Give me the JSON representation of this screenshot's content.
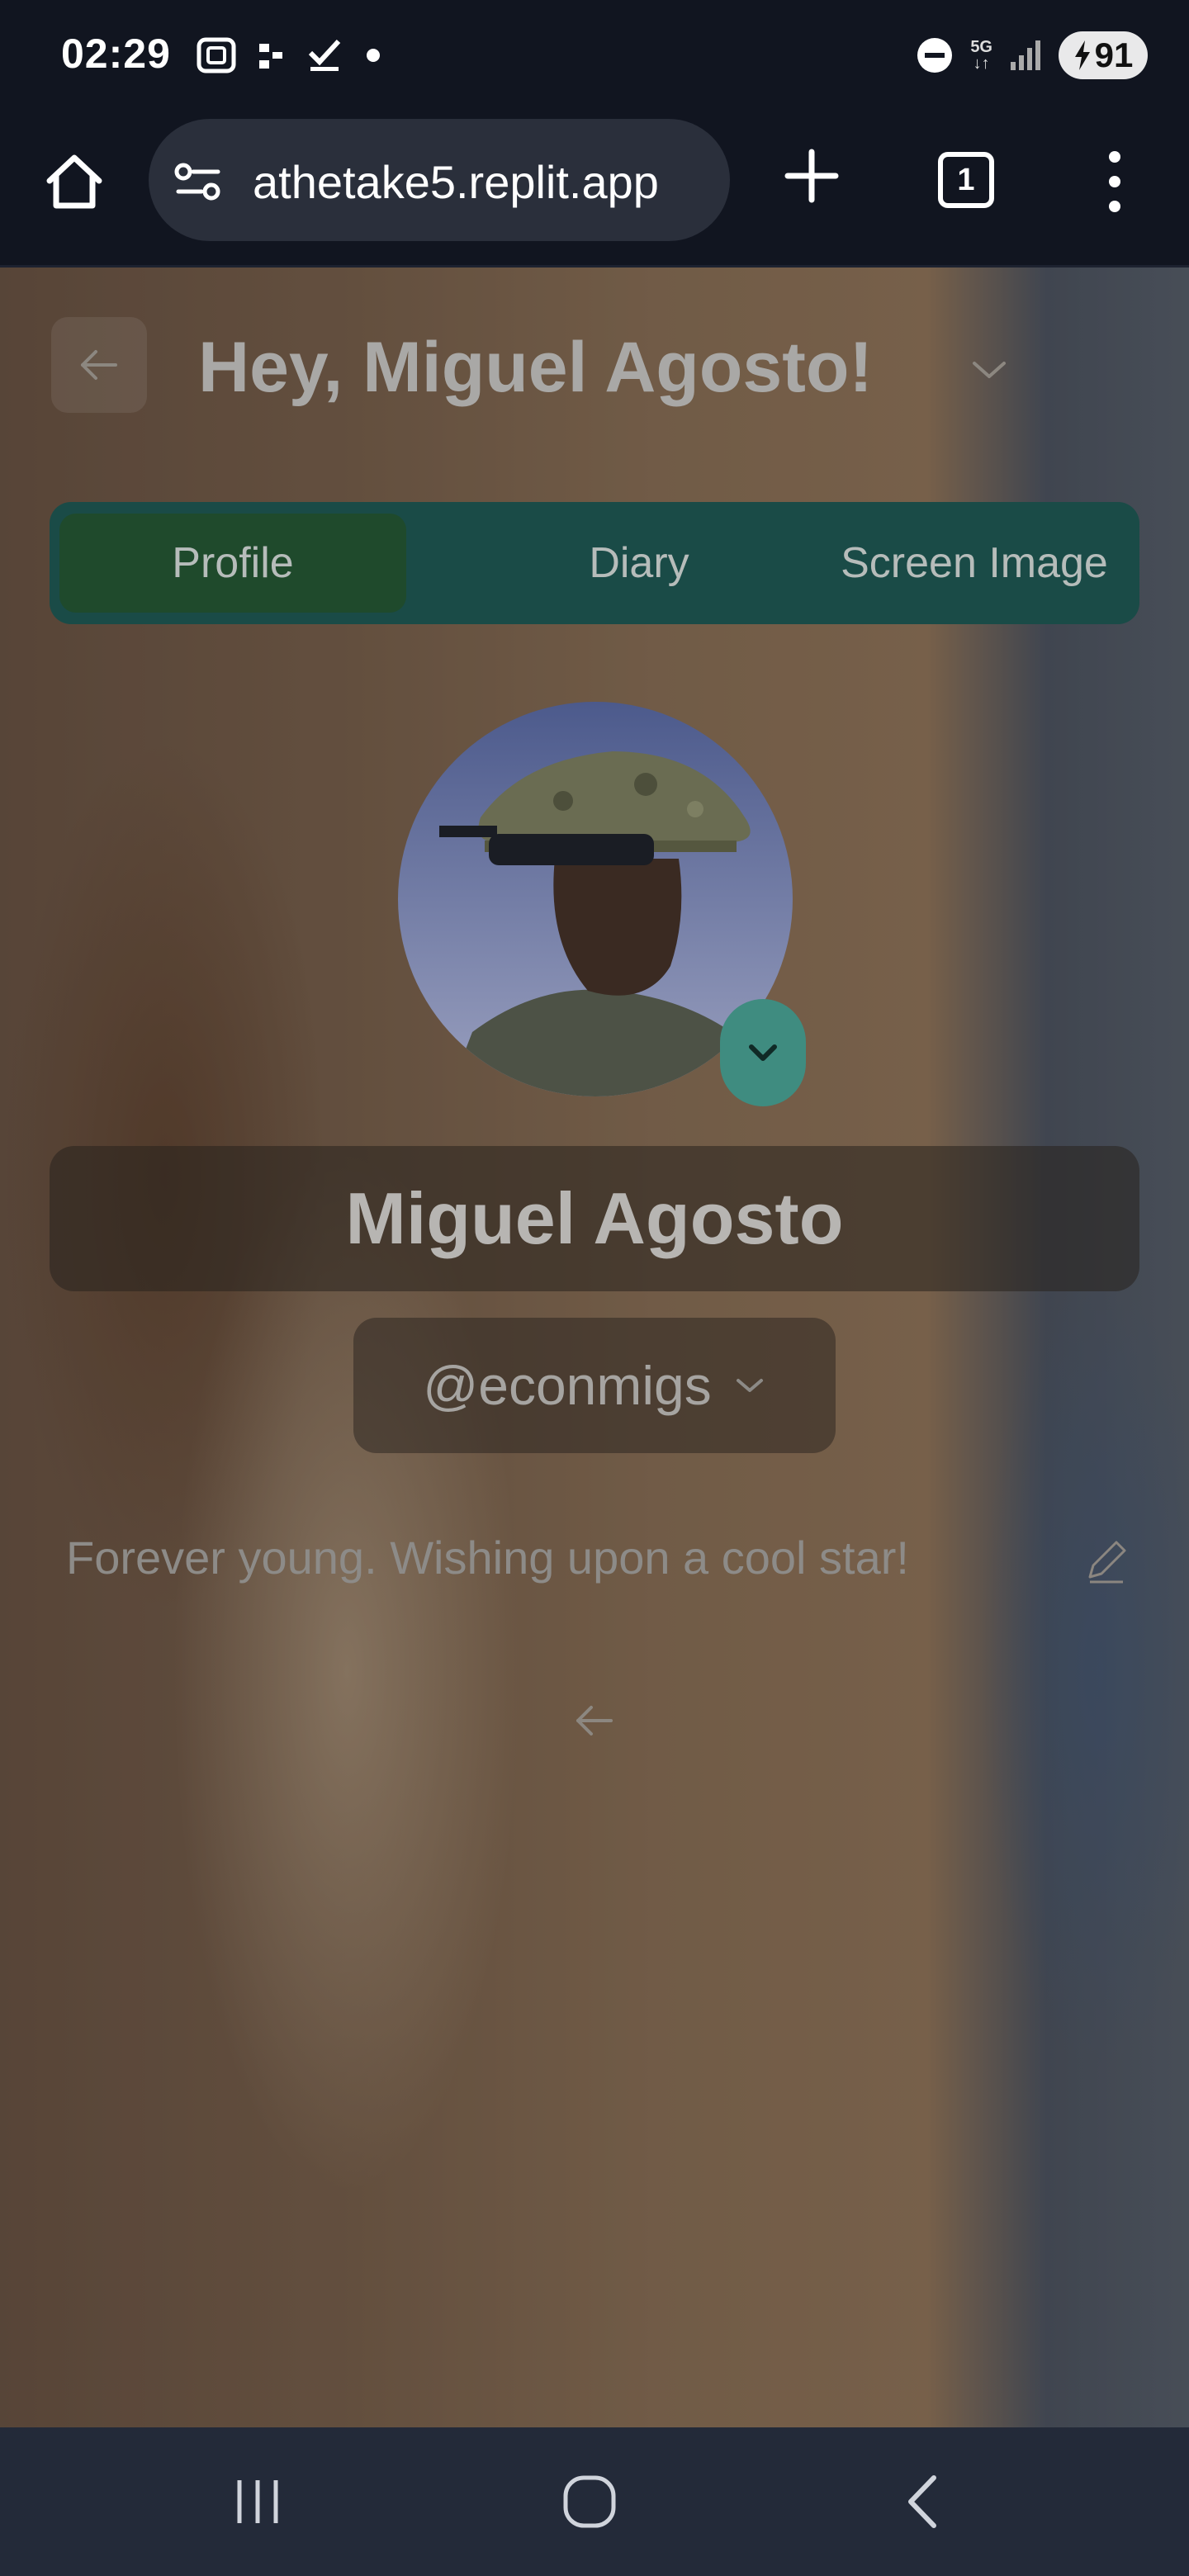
{
  "status_bar": {
    "time": "02:29",
    "network": "5G",
    "battery": "91",
    "icons": [
      "screenshot-icon",
      "cast-icon",
      "check-icon",
      "dot-icon",
      "do-not-disturb-icon",
      "signal-icon",
      "battery-charging-icon"
    ]
  },
  "browser": {
    "url": "athetake5.replit.app",
    "tab_count": "1",
    "icons": [
      "home-icon",
      "site-settings-icon",
      "new-tab-icon",
      "tabs-icon",
      "more-menu-icon"
    ]
  },
  "header": {
    "greeting": "Hey, Miguel Agosto!"
  },
  "tabs": [
    {
      "label": "Profile",
      "active": true
    },
    {
      "label": "Diary",
      "active": false
    },
    {
      "label": "Screen Image",
      "active": false
    }
  ],
  "profile": {
    "name": "Miguel Agosto",
    "handle": "@econmigs",
    "bio": "Forever young. Wishing upon a cool star!"
  },
  "colors": {
    "tab_bar": "#1a4b47",
    "active_tab": "#1f4a2c",
    "accent_button": "#3f8c80",
    "system_bar": "#111520",
    "nav_bar": "#232a39"
  }
}
